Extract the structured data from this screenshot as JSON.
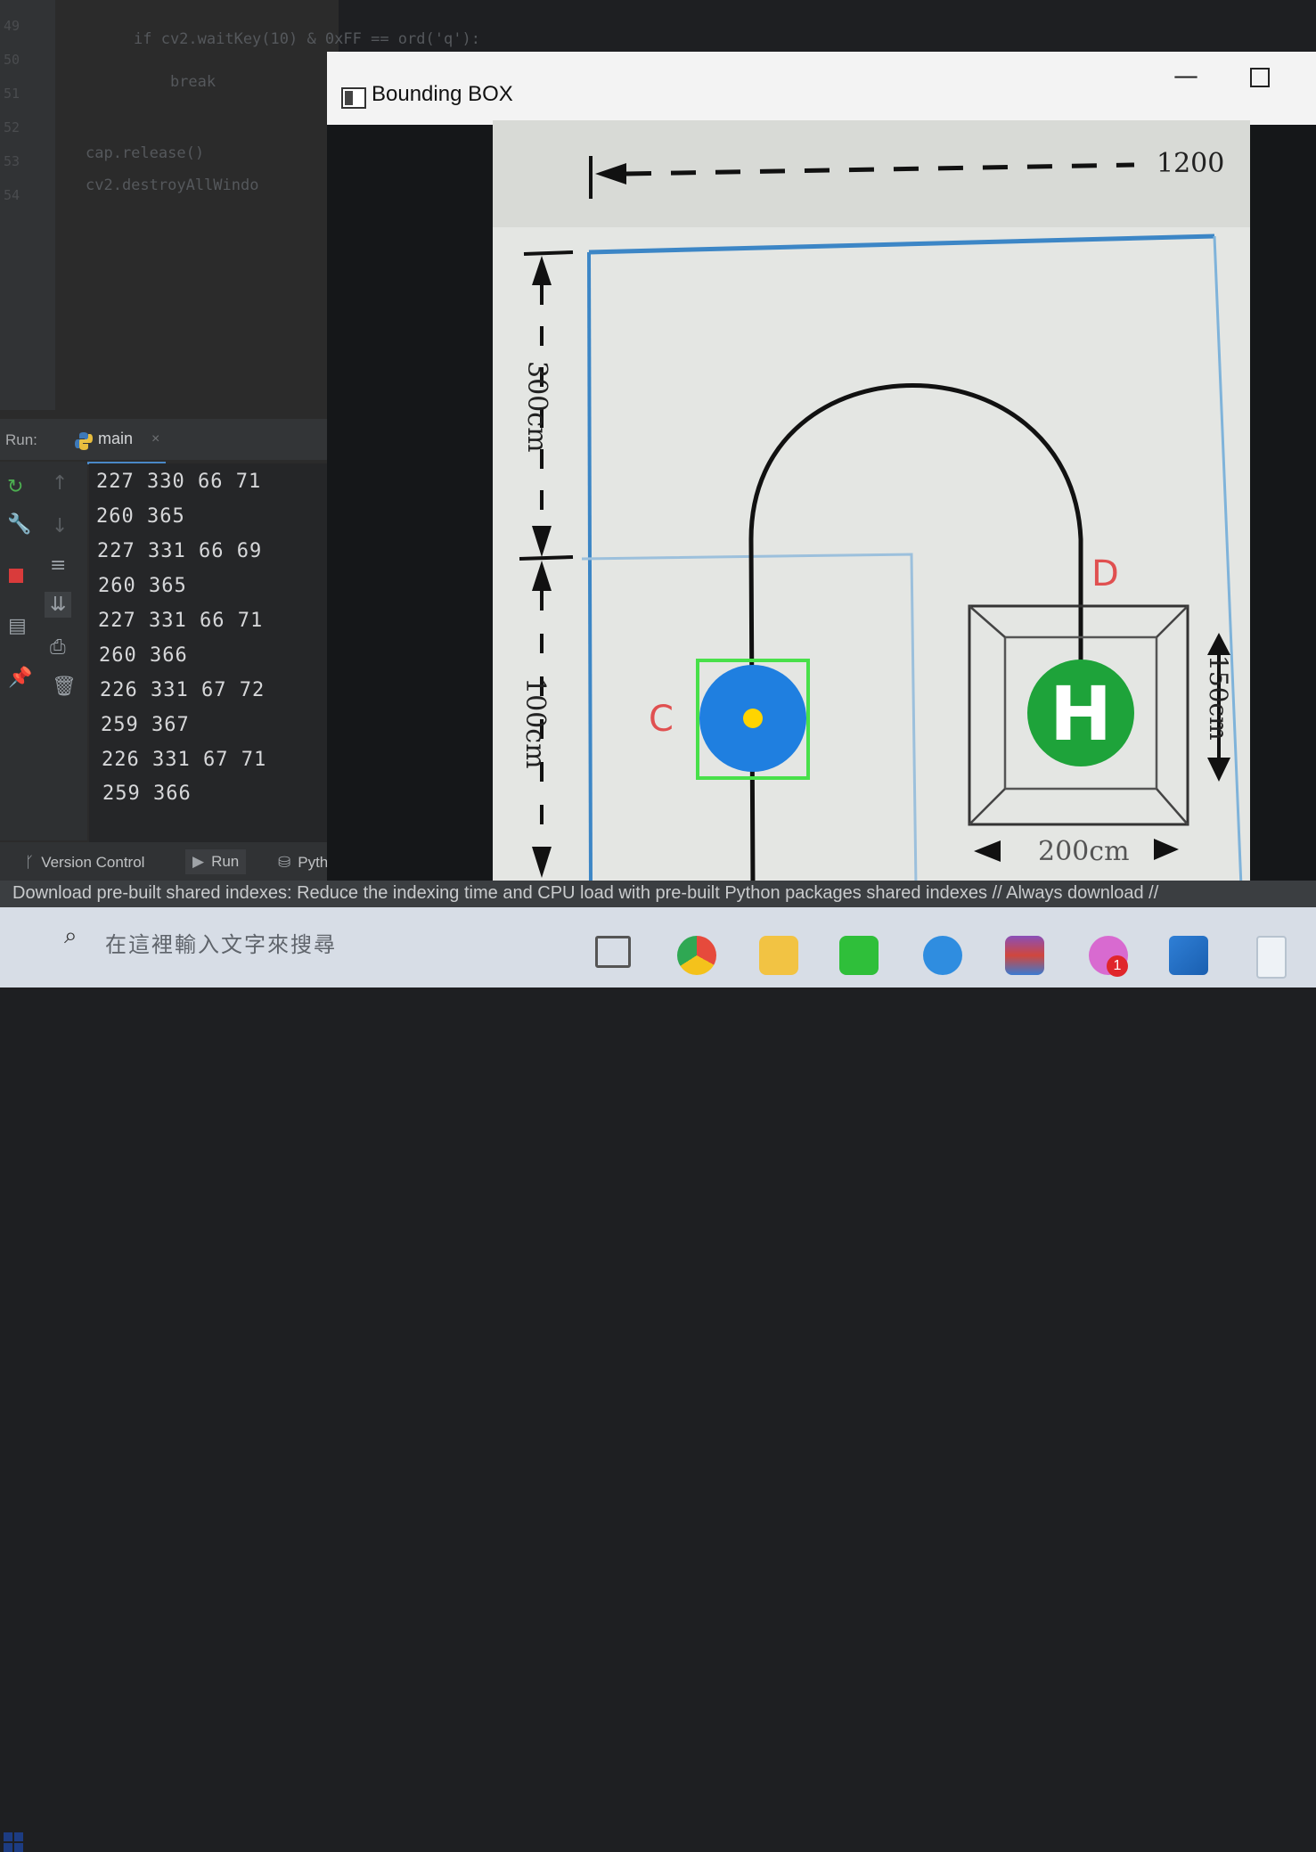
{
  "ide": {
    "line_numbers": [
      "49",
      "50",
      "51",
      "52",
      "53",
      "54"
    ],
    "code_lines": [
      "if cv2.waitKey(10) & 0xFF == ord('q'):",
      "    break",
      "cap.release()",
      "cv2.destroyAllWindo"
    ],
    "run_label": "Run:",
    "run_tab_name": "main",
    "tab_close": "×",
    "console_lines": [
      "227 330 66 71",
      "260 365",
      "227 331 66 69",
      "260 365",
      "227 331 66 71",
      "260 366",
      "226 331 67 72",
      "259 367",
      "226 331 67 71",
      "259 366"
    ],
    "bottom_tabs": {
      "version_control": "Version Control",
      "run": "Run",
      "python": "Pyth"
    }
  },
  "window": {
    "title": "Bounding BOX",
    "minimize_glyph": "—"
  },
  "diagram": {
    "top_dim_label": "1200",
    "left_dim_upper": "300cm",
    "left_dim_lower": "100cm",
    "right_dim": "150cm",
    "bottom_dim": "200cm",
    "label_c": "C",
    "label_d": "D",
    "label_h": "H",
    "colors": {
      "blue_disk": "#1f7fe0",
      "yellow_dot": "#ffd400",
      "green_disk": "#1ea33a",
      "bbox": "#48e04a",
      "labels": "#e05050",
      "frame": "#3c86c6"
    }
  },
  "status_bar": {
    "text": "Download pre-built shared indexes: Reduce the indexing time and CPU load with pre-built Python packages shared indexes // Always download //"
  },
  "taskbar": {
    "search_placeholder": "在這裡輸入文字來搜尋",
    "badge_count": "1"
  }
}
